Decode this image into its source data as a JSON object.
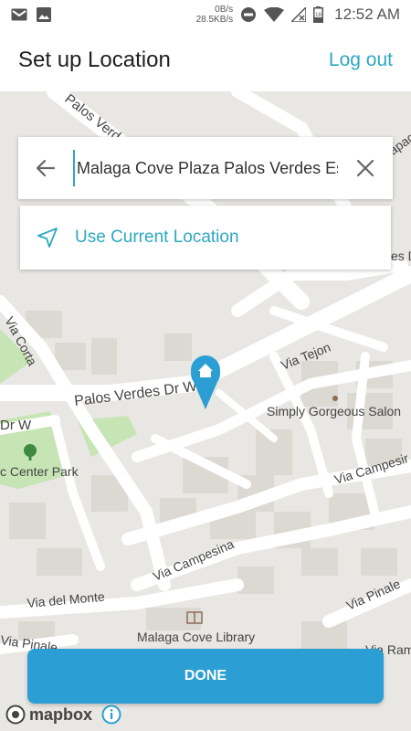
{
  "status_bar": {
    "net_up": "0B/s",
    "net_down": "28.5KB/s",
    "battery_level": "18",
    "time": "12:52 AM",
    "icons": [
      "gmail-icon",
      "image-icon",
      "do-not-disturb-icon",
      "wifi-icon",
      "no-signal-icon",
      "battery-icon"
    ]
  },
  "header": {
    "title": "Set up Location",
    "logout_label": "Log out"
  },
  "search": {
    "value": "Malaga Cove Plaza Palos Verdes Es",
    "back_icon": "arrow-left-icon",
    "clear_icon": "close-icon"
  },
  "current_location": {
    "label": "Use Current Location",
    "icon": "navigation-arrow-icon"
  },
  "map": {
    "labels": {
      "palos_verdes_dr_w_top": "Palos Verdes",
      "palos_verdes_dr_w_main": "Palos Verdes Dr W",
      "dr_w_left": "Dr W",
      "via_corta": "Via Corta",
      "via_tejon": "Via Tejon",
      "simply_gorgeous": "Simply Gorgeous Salon",
      "civic_center_park": "c Center Park",
      "via_campesina_right": "Via Campesir",
      "via_campesina_mid": "Via Campesina",
      "via_del_monte": "Via del Monte",
      "via_pinale_right": "Via Pinale",
      "via_pinale_left": "Via Pinale",
      "malaga_library": "Malaga Cove Library",
      "via_rame": "Via Rame",
      "apaquey": "apaqu",
      "es_dr": "es Dr"
    },
    "pin_icon": "home-pin-icon"
  },
  "done_label": "DONE",
  "attribution": {
    "brand": "mapbox",
    "info_icon": "info-icon"
  },
  "colors": {
    "accent": "#2ea8c2",
    "done_button": "#2b9fd3",
    "map_bg": "#e9e7e3",
    "road": "#ffffff",
    "park": "#c6e4b4",
    "building": "#dcd9d3"
  }
}
